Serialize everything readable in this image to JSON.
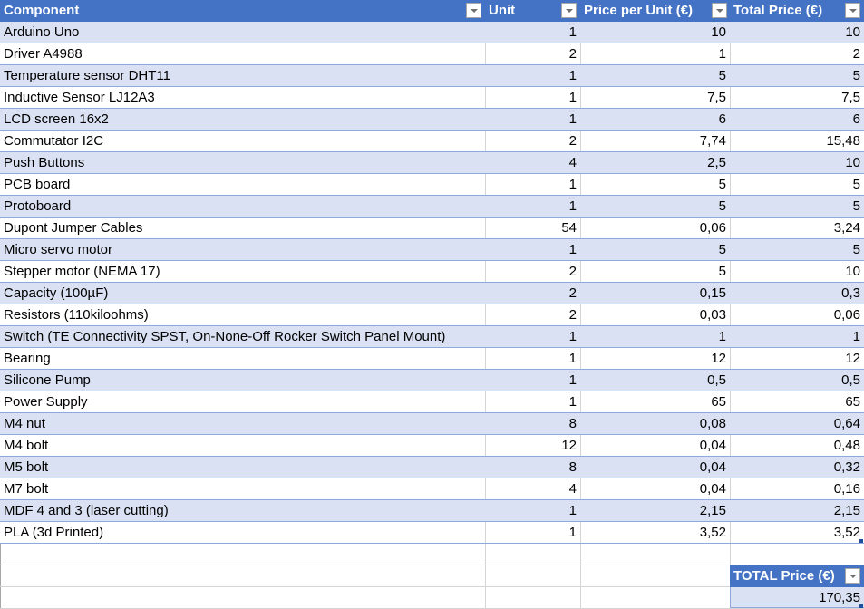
{
  "table": {
    "headers": [
      "Component",
      "Unit",
      "Price per Unit (€)",
      "Total Price (€)"
    ],
    "rows": [
      [
        "Arduino Uno",
        "1",
        "10",
        "10"
      ],
      [
        "Driver A4988",
        "2",
        "1",
        "2"
      ],
      [
        "Temperature sensor DHT11",
        "1",
        "5",
        "5"
      ],
      [
        "Inductive Sensor LJ12A3",
        "1",
        "7,5",
        "7,5"
      ],
      [
        "LCD screen 16x2",
        "1",
        "6",
        "6"
      ],
      [
        "Commutator I2C",
        "2",
        "7,74",
        "15,48"
      ],
      [
        "Push Buttons",
        "4",
        "2,5",
        "10"
      ],
      [
        "PCB board",
        "1",
        "5",
        "5"
      ],
      [
        "Protoboard",
        "1",
        "5",
        "5"
      ],
      [
        "Dupont Jumper Cables",
        "54",
        "0,06",
        "3,24"
      ],
      [
        "Micro servo motor",
        "1",
        "5",
        "5"
      ],
      [
        "Stepper motor (NEMA 17)",
        "2",
        "5",
        "10"
      ],
      [
        "Capacity (100µF)",
        "2",
        "0,15",
        "0,3"
      ],
      [
        "Resistors (110kiloohms)",
        "2",
        "0,03",
        "0,06"
      ],
      [
        "Switch (TE Connectivity SPST, On-None-Off Rocker Switch Panel Mount)",
        "1",
        "1",
        "1"
      ],
      [
        "Bearing",
        "1",
        "12",
        "12"
      ],
      [
        "Silicone Pump",
        "1",
        "0,5",
        "0,5"
      ],
      [
        "Power Supply",
        "1",
        "65",
        "65"
      ],
      [
        "M4 nut",
        "8",
        "0,08",
        "0,64"
      ],
      [
        "M4 bolt",
        "12",
        "0,04",
        "0,48"
      ],
      [
        "M5 bolt",
        "8",
        "0,04",
        "0,32"
      ],
      [
        "M7 bolt",
        "4",
        "0,04",
        "0,16"
      ],
      [
        "MDF 4 and 3 (laser cutting)",
        "1",
        "2,15",
        "2,15"
      ],
      [
        "PLA (3d Printed)",
        "1",
        "3,52",
        "3,52"
      ]
    ]
  },
  "total": {
    "header": "TOTAL Price (€)",
    "value": "170,35"
  },
  "colors": {
    "header_bg": "#4472c4",
    "band_bg": "#d9e1f2",
    "border": "#8ea9db"
  }
}
